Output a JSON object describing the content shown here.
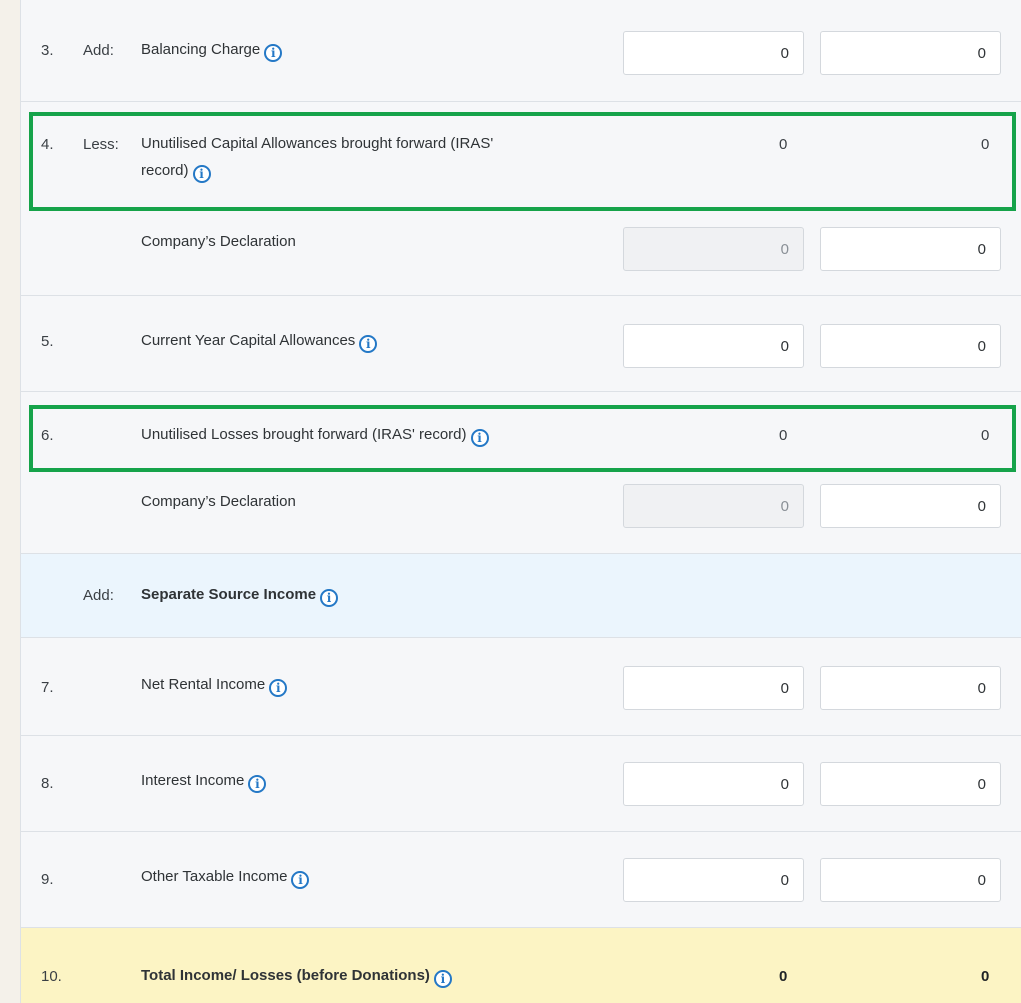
{
  "rows": {
    "r3": {
      "num": "3.",
      "prefix": "Add:",
      "label": "Balancing Charge",
      "v1": "0",
      "v2": "0"
    },
    "r4": {
      "num": "4.",
      "prefix": "Less:",
      "label_line1": "Unutilised Capital Allowances brought forward (IRAS'",
      "label_line2": "record)",
      "v1": "0",
      "v2": "0"
    },
    "r4b": {
      "label": "Company’s Declaration",
      "v1": "0",
      "v2": "0"
    },
    "r5": {
      "num": "5.",
      "label": "Current Year Capital Allowances",
      "v1": "0",
      "v2": "0"
    },
    "r6": {
      "num": "6.",
      "label": "Unutilised Losses brought forward (IRAS' record)",
      "v1": "0",
      "v2": "0"
    },
    "r6b": {
      "label": "Company’s Declaration",
      "v1": "0",
      "v2": "0"
    },
    "section": {
      "prefix": "Add:",
      "label": "Separate Source Income"
    },
    "r7": {
      "num": "7.",
      "label": "Net Rental Income",
      "v1": "0",
      "v2": "0"
    },
    "r8": {
      "num": "8.",
      "label": "Interest Income",
      "v1": "0",
      "v2": "0"
    },
    "r9": {
      "num": "9.",
      "label": "Other Taxable Income",
      "v1": "0",
      "v2": "0"
    },
    "r10": {
      "num": "10.",
      "label": "Total Income/ Losses (before Donations)",
      "v1": "0",
      "v2": "0"
    }
  },
  "icons": {
    "info": "info-icon",
    "info_glyph": "i"
  },
  "colors": {
    "highlight": "#16a34a",
    "info": "#2478c6",
    "section_bg": "#ebf5fd",
    "total_bg": "#fcf4c4"
  }
}
